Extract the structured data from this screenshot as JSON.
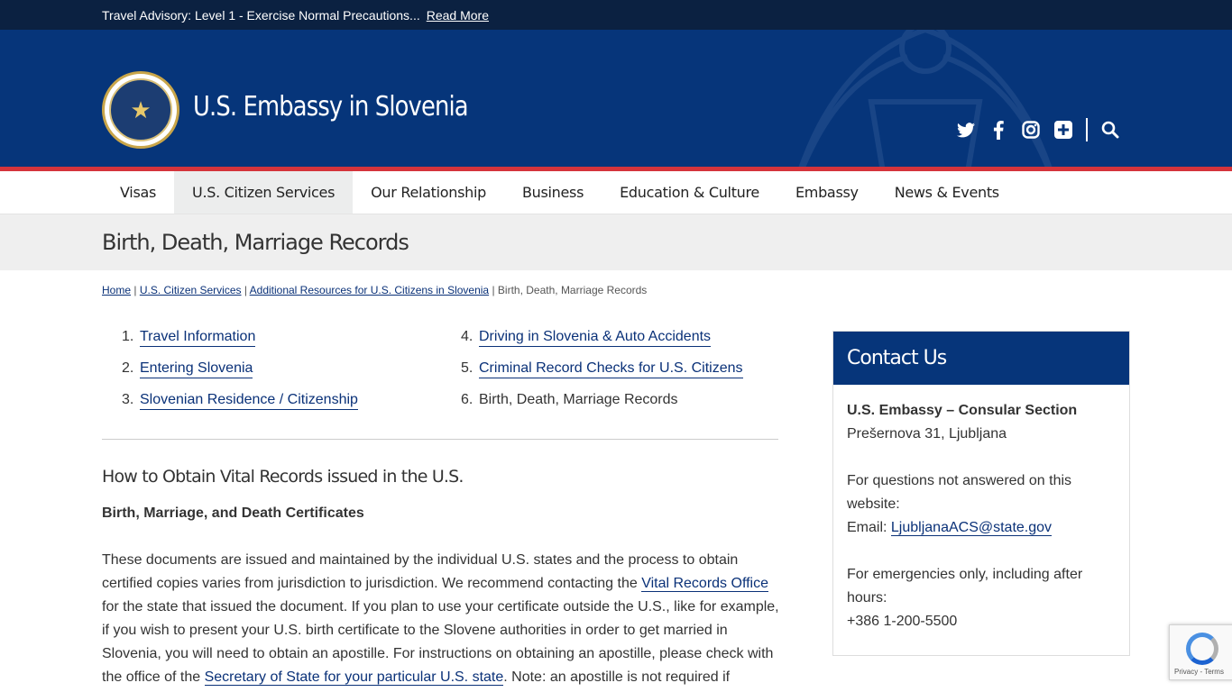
{
  "advisory": {
    "text": "Travel Advisory: Level 1 - Exercise Normal Precautions...",
    "link": "Read More"
  },
  "header": {
    "title": "U.S. Embassy in Slovenia",
    "seal_icon": "state-department-seal"
  },
  "social": [
    "twitter-icon",
    "facebook-icon",
    "instagram-icon",
    "plus-icon",
    "search-icon"
  ],
  "nav": [
    {
      "label": "Visas"
    },
    {
      "label": "U.S. Citizen Services",
      "active": true
    },
    {
      "label": "Our Relationship"
    },
    {
      "label": "Business"
    },
    {
      "label": "Education & Culture"
    },
    {
      "label": "Embassy"
    },
    {
      "label": "News & Events"
    }
  ],
  "page_title": "Birth, Death, Marriage Records",
  "breadcrumb": {
    "home": "Home",
    "sep": " | ",
    "c1": "U.S. Citizen Services",
    "c2": "Additional Resources for U.S. Citizens in Slovenia",
    "current": "Birth, Death, Marriage Records"
  },
  "topics": [
    {
      "num": "1.",
      "label": "Travel Information"
    },
    {
      "num": "2.",
      "label": "Entering Slovenia"
    },
    {
      "num": "3.",
      "label": "Slovenian Residence / Citizenship"
    },
    {
      "num": "4.",
      "label": "Driving in Slovenia & Auto Accidents"
    },
    {
      "num": "5.",
      "label": "Criminal Record Checks for U.S. Citizens"
    },
    {
      "num": "6.",
      "label": "Birth, Death, Marriage Records"
    }
  ],
  "section": {
    "heading": "How to Obtain Vital Records issued in the U.S.",
    "subheading": "Birth, Marriage, and Death Certificates",
    "p1": "These documents are issued and maintained by the individual U.S. states and the process to obtain certified copies varies from jurisdiction to jurisdiction.  We recommend contacting the ",
    "link1": "Vital Records Office",
    "p2": " for the state that issued the document.  If you plan to use your certificate outside the U.S., like for example, if you wish to present your U.S. birth certificate to the Slovene authorities in order to get married in Slovenia, you will need to obtain an apostille.  For instructions on obtaining an apostille, please check with the office of the ",
    "link2": "Secretary of State for your particular U.S. state",
    "p3": ".  Note: an apostille is not required if"
  },
  "contact": {
    "heading": "Contact Us",
    "org": "U.S. Embassy – Consular Section",
    "address": "Prešernova 31, Ljubljana",
    "q_text": "For questions not answered on this website:",
    "email_label": "Email: ",
    "email": "LjubljanaACS@state.gov",
    "emergency_text": "For emergencies only, including after hours:",
    "phone": "+386 1-200-5500"
  },
  "recaptcha": {
    "text": "Privacy - Terms"
  }
}
